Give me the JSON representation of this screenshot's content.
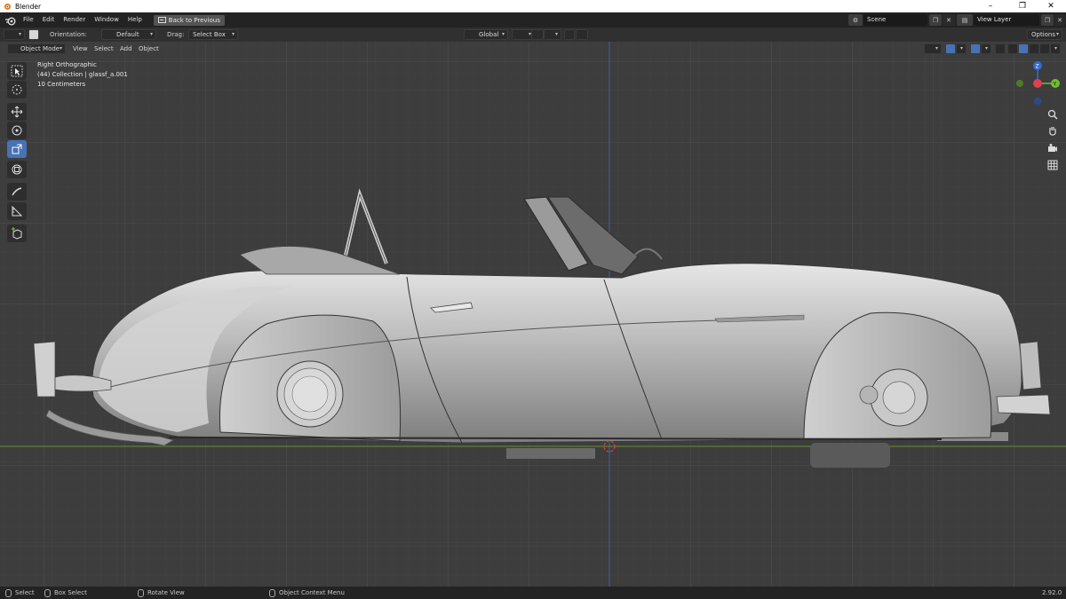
{
  "window": {
    "title": "Blender"
  },
  "menubar": {
    "items": [
      "File",
      "Edit",
      "Render",
      "Window",
      "Help"
    ],
    "back_button": "Back to Previous",
    "scene": "Scene",
    "view_layer": "View Layer"
  },
  "tool_header": {
    "orientation_label": "Orientation:",
    "orientation_value": "Default",
    "drag_label": "Drag:",
    "drag_value": "Select Box",
    "transform_orientation": "Global",
    "options_label": "Options"
  },
  "viewport_header": {
    "mode": "Object Mode",
    "menus": [
      "View",
      "Select",
      "Add",
      "Object"
    ]
  },
  "viewport_overlay": {
    "view_name": "Right Orthographic",
    "collection": "(44) Collection | glassf_a.001",
    "scale": "10 Centimeters"
  },
  "gizmo": {
    "z": "Z",
    "y": "Y"
  },
  "statusbar": {
    "select": "Select",
    "box_select": "Box Select",
    "rotate_view": "Rotate View",
    "context_menu": "Object Context Menu",
    "version": "2.92.0"
  },
  "colors": {
    "active_tool": "#4772b3",
    "z_axis": "#2f6bd1",
    "y_axis": "#6fbf2b",
    "x_axis": "#e23f4d",
    "viewport_bg": "#3d3d3d"
  }
}
